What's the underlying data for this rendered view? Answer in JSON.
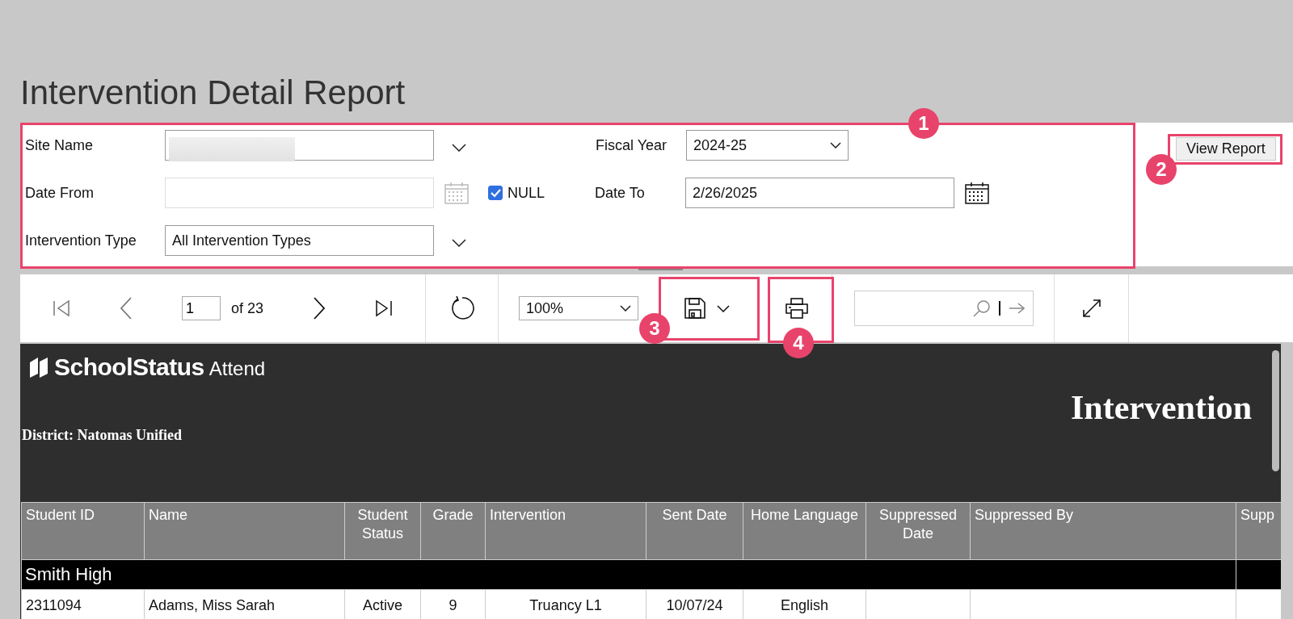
{
  "page_title": "Intervention Detail Report",
  "parameters": {
    "site_name": {
      "label": "Site Name",
      "redacted": true
    },
    "date_from": {
      "label": "Date From",
      "null_checkbox": {
        "label": "NULL",
        "checked": true
      }
    },
    "intervention_type": {
      "label": "Intervention Type",
      "value": "All Intervention Types"
    },
    "fiscal_year": {
      "label": "Fiscal Year",
      "value": "2024-25"
    },
    "date_to": {
      "label": "Date To",
      "value": "2/26/2025"
    }
  },
  "view_report_button": "View Report",
  "toolbar": {
    "page": "1",
    "page_count": "of 23",
    "zoom": "100%"
  },
  "report": {
    "brand": "SchoolStatus",
    "product": "Attend",
    "district": "District: Natomas Unified",
    "title": "Intervention",
    "columns": [
      "Student ID",
      "Name",
      "Student Status",
      "Grade",
      "Intervention",
      "Sent Date",
      "Home Language",
      "Suppressed Date",
      "Suppressed By",
      "Supp"
    ],
    "groups": [
      {
        "name": "Smith High",
        "rows": [
          [
            "2311094",
            "Adams, Miss Sarah",
            "Active",
            "9",
            "Truancy L1",
            "10/07/24",
            "English"
          ]
        ]
      }
    ]
  },
  "annotations": [
    {
      "label": "1"
    },
    {
      "label": "2"
    },
    {
      "label": "3"
    },
    {
      "label": "4"
    }
  ]
}
